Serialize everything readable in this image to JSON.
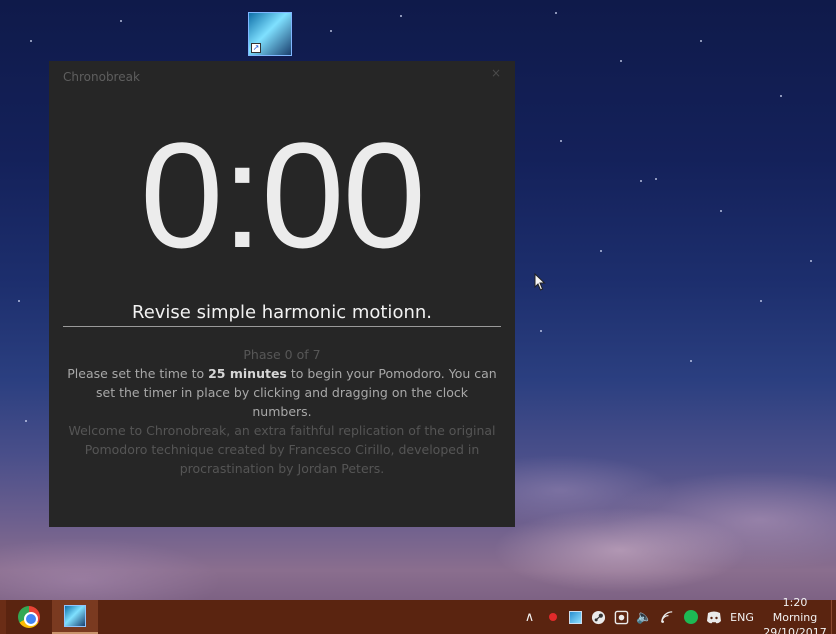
{
  "app": {
    "title": "Chronobreak",
    "close_glyph": "×",
    "timer": "0:00",
    "task_value": "Revise simple harmonic motionn.",
    "phase": "Phase 0 of 7",
    "instruction_pre": "Please set the time to ",
    "instruction_bold": "25 minutes",
    "instruction_post": " to begin your Pomodoro. You can set the timer in place by clicking and dragging on the clock numbers.",
    "welcome": "Welcome to Chronobreak, an extra faithful replication of the original Pomodoro technique created by Francesco Cirillo, developed in procrastination by Jordan Peters."
  },
  "desktop_icon": {
    "icon": "chronobreak-shortcut-icon",
    "shortcut_glyph": "↗"
  },
  "taskbar": {
    "pinned": [
      "chrome-icon",
      "chronobreak-icon"
    ],
    "tray": {
      "chevron_glyph": "∧",
      "volume_glyph": "🔈",
      "lang": "ENG",
      "time": "1:20 Morning",
      "date": "29/10/2017"
    }
  }
}
